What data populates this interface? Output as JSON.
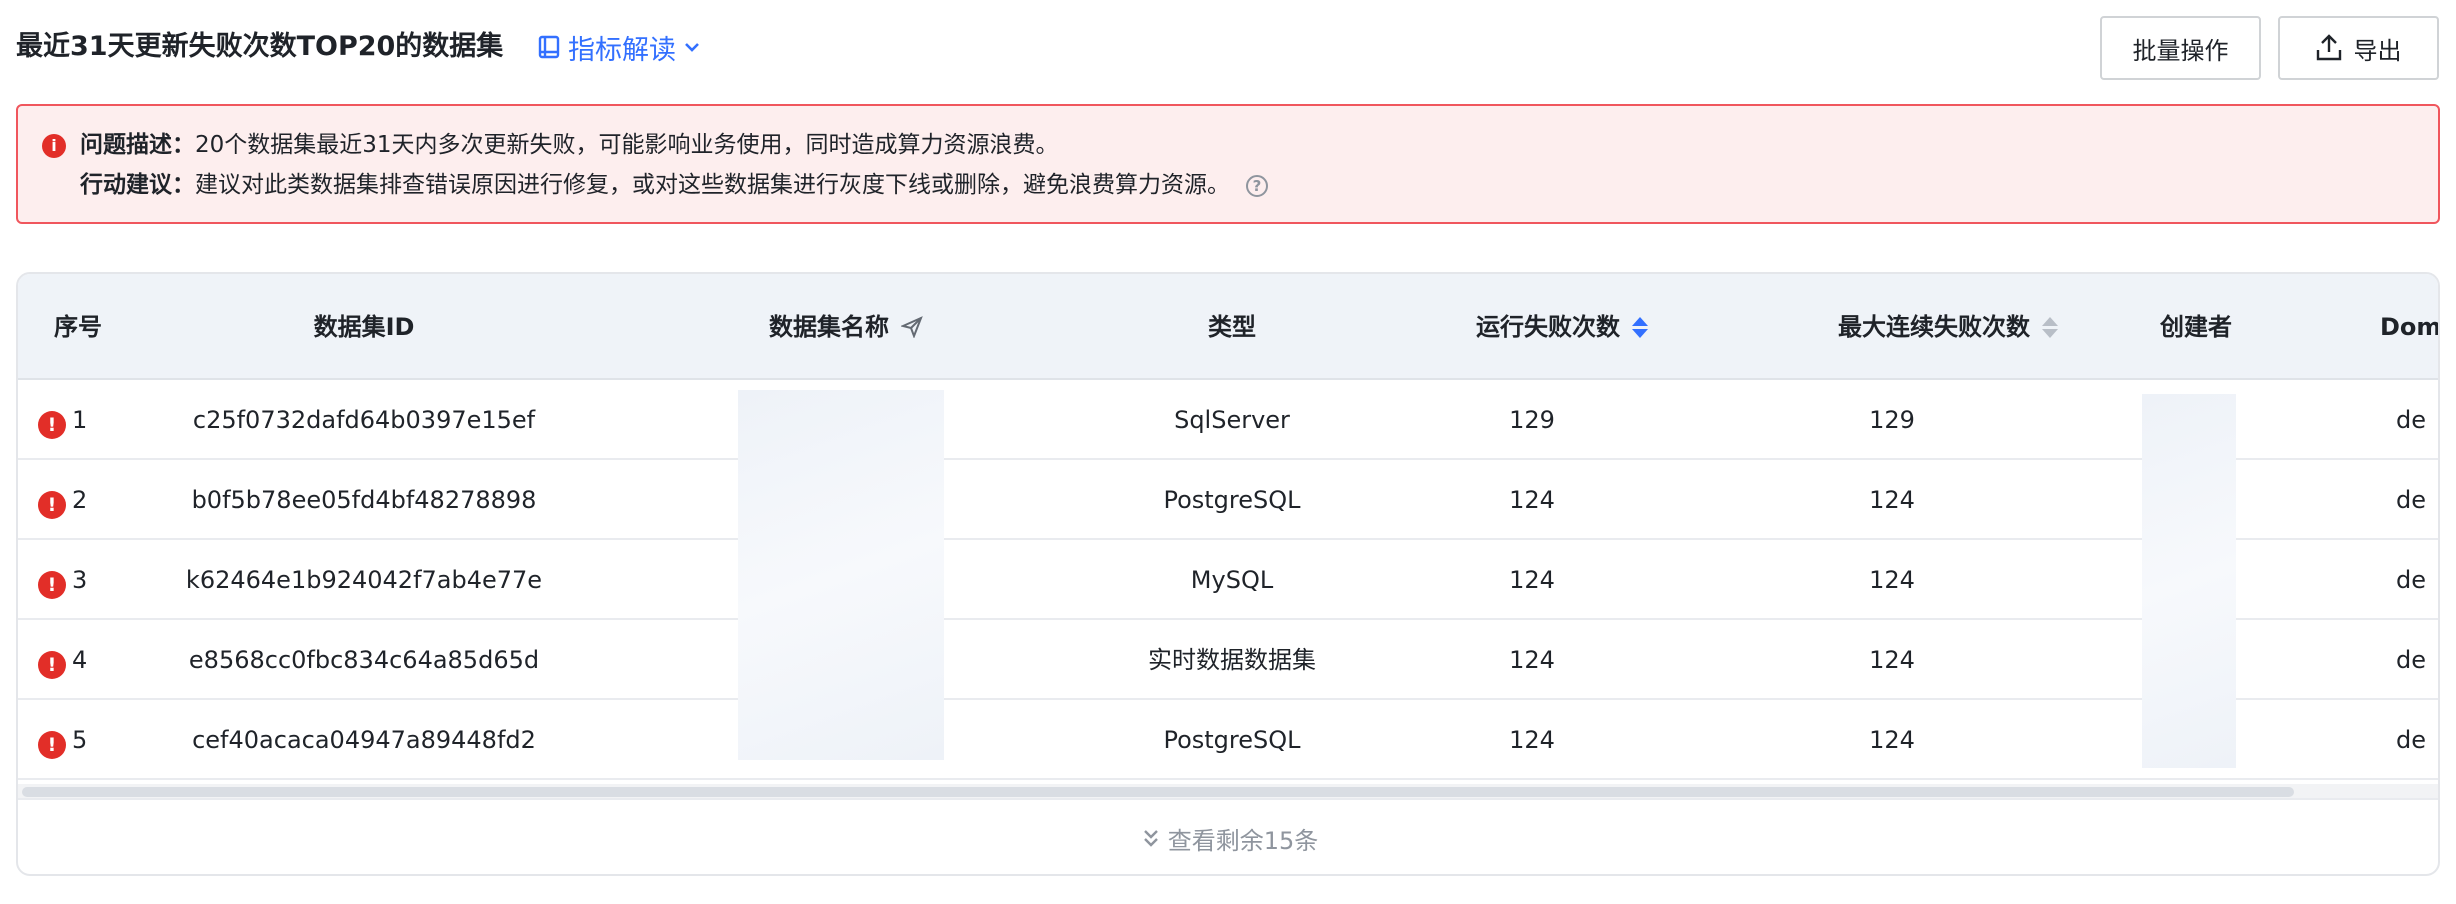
{
  "header": {
    "title": "最近31天更新失败次数TOP20的数据集",
    "guide_label": "指标解读",
    "batch_button": "批量操作",
    "export_button": "导出"
  },
  "alert": {
    "problem_label": "问题描述：",
    "problem_text": "20个数据集最近31天内多次更新失败，可能影响业务使用，同时造成算力资源浪费。",
    "action_label": "行动建议：",
    "action_text": "建议对此类数据集排查错误原因进行修复，或对这些数据集进行灰度下线或删除，避免浪费算力资源。"
  },
  "table": {
    "columns": {
      "index": "序号",
      "dataset_id": "数据集ID",
      "dataset_name": "数据集名称",
      "type": "类型",
      "run_failures": "运行失败次数",
      "max_consecutive_failures": "最大连续失败次数",
      "creator": "创建者",
      "domain": "Doma"
    },
    "rows": [
      {
        "index": "1",
        "dataset_id": "c25f0732dafd64b0397e15ef",
        "type": "SqlServer",
        "run_failures": "129",
        "max_consecutive_failures": "129",
        "domain": "de"
      },
      {
        "index": "2",
        "dataset_id": "b0f5b78ee05fd4bf48278898",
        "type": "PostgreSQL",
        "run_failures": "124",
        "max_consecutive_failures": "124",
        "domain": "de"
      },
      {
        "index": "3",
        "dataset_id": "k62464e1b924042f7ab4e77e",
        "type": "MySQL",
        "run_failures": "124",
        "max_consecutive_failures": "124",
        "domain": "de"
      },
      {
        "index": "4",
        "dataset_id": "e8568cc0fbc834c64a85d65d",
        "type": "实时数据数据集",
        "run_failures": "124",
        "max_consecutive_failures": "124",
        "domain": "de"
      },
      {
        "index": "5",
        "dataset_id": "cef40acaca04947a89448fd2",
        "type": "PostgreSQL",
        "run_failures": "124",
        "max_consecutive_failures": "124",
        "domain": "de"
      }
    ],
    "show_more": "查看剩余15条"
  },
  "colors": {
    "accent": "#3370ff",
    "error": "#e22e28",
    "alert_bg": "#fdeeee",
    "alert_border": "#f0565d",
    "header_bg": "#eff3f8"
  },
  "icons": {
    "guide": "book-icon",
    "guide_chevron": "chevron-down-icon",
    "export": "upload-icon",
    "alert": "info-icon",
    "help": "question-circle-icon",
    "row_status": "exclamation-circle-icon",
    "name_column": "send-icon",
    "sort": "sort-icon",
    "show_more": "double-chevron-down-icon"
  }
}
